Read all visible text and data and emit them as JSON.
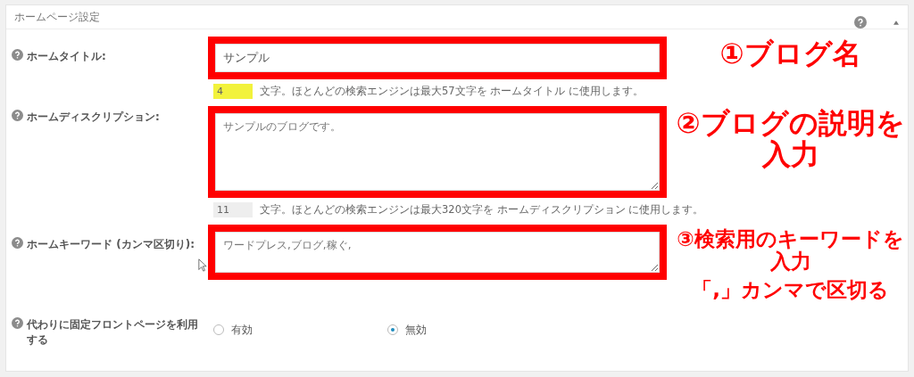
{
  "panel": {
    "title": "ホームページ設定"
  },
  "fields": [
    {
      "kind": "text",
      "label": "ホームタイトル:",
      "value": "サンプル",
      "count": "4",
      "count_highlight": true,
      "hint": "文字。ほとんどの検索エンジンは最大57文字を ホームタイトル に使用します。",
      "annotations": [
        {
          "text": "①ブログ名"
        }
      ]
    },
    {
      "kind": "textarea",
      "label": "ホームディスクリプション:",
      "value": "サンプルのブログです。",
      "count": "11",
      "count_highlight": false,
      "hint": "文字。ほとんどの検索エンジンは最大320文字を ホームディスクリプション に使用します。",
      "annotations": [
        {
          "text": "②ブログの説明を入力"
        }
      ]
    },
    {
      "kind": "keywords",
      "label": "ホームキーワード (カンマ区切り):",
      "value": "ワードプレス,ブログ,稼ぐ,",
      "annotations": [
        {
          "text": "③検索用のキーワードを入力"
        },
        {
          "text": "「,」カンマで区切る"
        }
      ]
    },
    {
      "kind": "radio",
      "label": "代わりに固定フロントページを利用する",
      "options": [
        {
          "label": "有効",
          "selected": false
        },
        {
          "label": "無効",
          "selected": true
        }
      ]
    }
  ]
}
